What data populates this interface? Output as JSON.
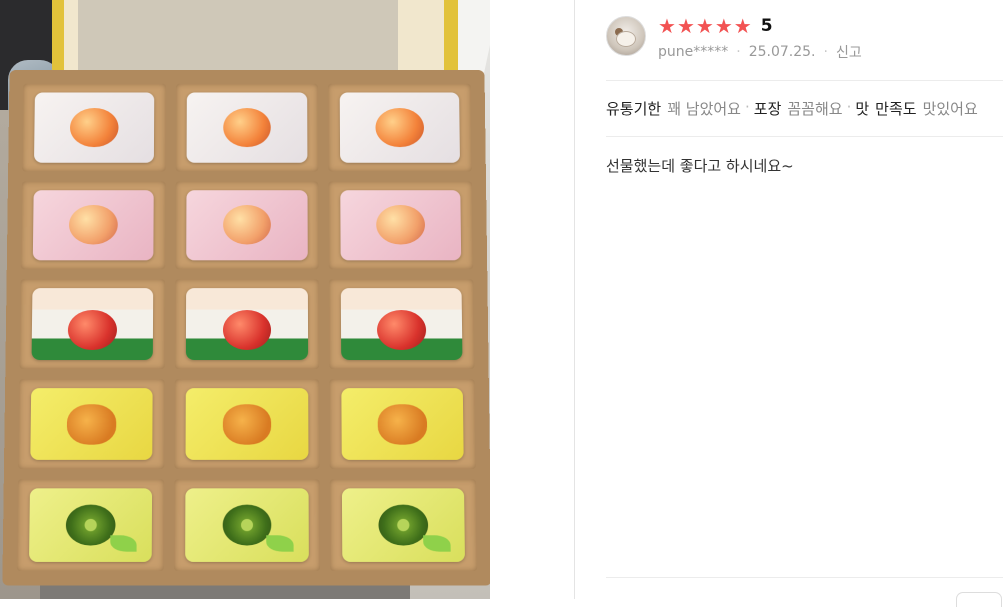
{
  "photo": {
    "alt_subject": "gift box of fruit-shaped breads",
    "rows": [
      [
        "peach",
        "peach",
        "peach"
      ],
      [
        "peach-pink",
        "peach-pink",
        "peach-pink"
      ],
      [
        "apple",
        "apple",
        "apple"
      ],
      [
        "pumpkin",
        "pumpkin",
        "pumpkin"
      ],
      [
        "kiwi",
        "kiwi",
        "kiwi"
      ]
    ]
  },
  "review": {
    "rating": 5,
    "rating_label": "5",
    "star_icon": "star-icon",
    "star_color": "#f25252",
    "username": "pune*****",
    "date": "25.07.25.",
    "report_label": "신고",
    "attributes": [
      {
        "key": "유통기한",
        "value": "꽤 남았어요"
      },
      {
        "key": "포장",
        "value": "꼼꼼해요"
      },
      {
        "key": "맛",
        "value": "만족도"
      },
      {
        "key": "",
        "value": "맛있어요"
      }
    ],
    "content": "선물했는데 좋다고 하시네요~"
  }
}
